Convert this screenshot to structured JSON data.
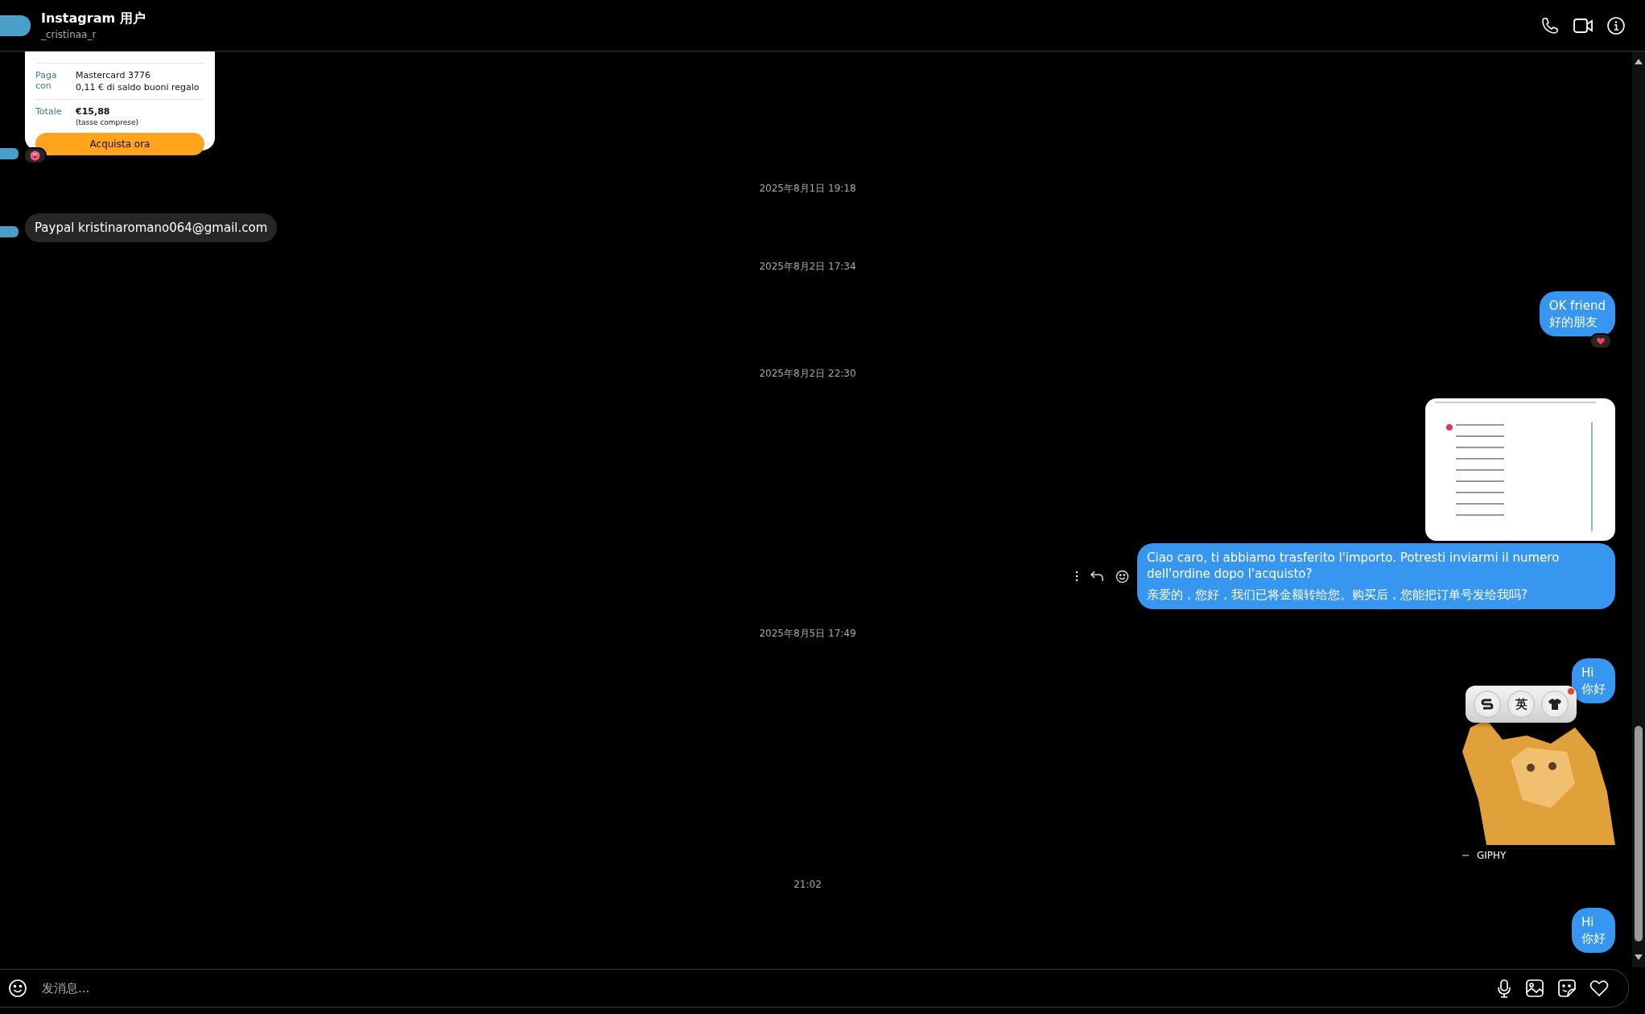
{
  "header": {
    "title": "Instagram 用户",
    "username": "_cristinaa_r"
  },
  "messages": [
    {
      "kind": "order_card",
      "outgoing": false,
      "rows": [
        {
          "label": "Paga con",
          "lines": [
            "Mastercard 3776",
            "0,11 € di saldo buoni regalo"
          ]
        },
        {
          "label": "Totale",
          "total": "€15,88",
          "note": "(tasse comprese)"
        }
      ],
      "button": "Acquista ora",
      "reaction": {
        "kind": "heart-eyes"
      }
    },
    {
      "kind": "time",
      "text": "2025年8月1日 19:18"
    },
    {
      "kind": "text",
      "outgoing": false,
      "lines": [
        "Paypal kristinaromano064@gmail.com"
      ]
    },
    {
      "kind": "time",
      "text": "2025年8月2日 17:34"
    },
    {
      "kind": "text",
      "outgoing": true,
      "lines": [
        "OK friend",
        "好的朋友"
      ],
      "reaction": {
        "kind": "heart"
      }
    },
    {
      "kind": "time",
      "text": "2025年8月2日 22:30"
    },
    {
      "kind": "image",
      "outgoing": true
    },
    {
      "kind": "text",
      "outgoing": true,
      "lines": [
        "Ciao caro, ti abbiamo trasferito l'importo. Potresti inviarmi il numero dell'ordine dopo l'acquisto?",
        "亲爱的，您好，我们已将金额转给您。购买后，您能把订单号发给我吗?"
      ],
      "actions_shown": true
    },
    {
      "kind": "time",
      "text": "2025年8月5日 17:49"
    },
    {
      "kind": "text",
      "outgoing": true,
      "lines": [
        "Hi",
        "你好"
      ]
    },
    {
      "kind": "sticker",
      "outgoing": true,
      "caption": "GIPHY"
    },
    {
      "kind": "time",
      "text": "21:02"
    },
    {
      "kind": "text",
      "outgoing": true,
      "lines": [
        "Hi",
        "你好"
      ]
    }
  ],
  "ime_toolbar": {
    "buttons": [
      {
        "kind": "logo"
      },
      {
        "kind": "label",
        "text": "英"
      },
      {
        "kind": "shirt"
      }
    ]
  },
  "input": {
    "placeholder": "发消息..."
  }
}
